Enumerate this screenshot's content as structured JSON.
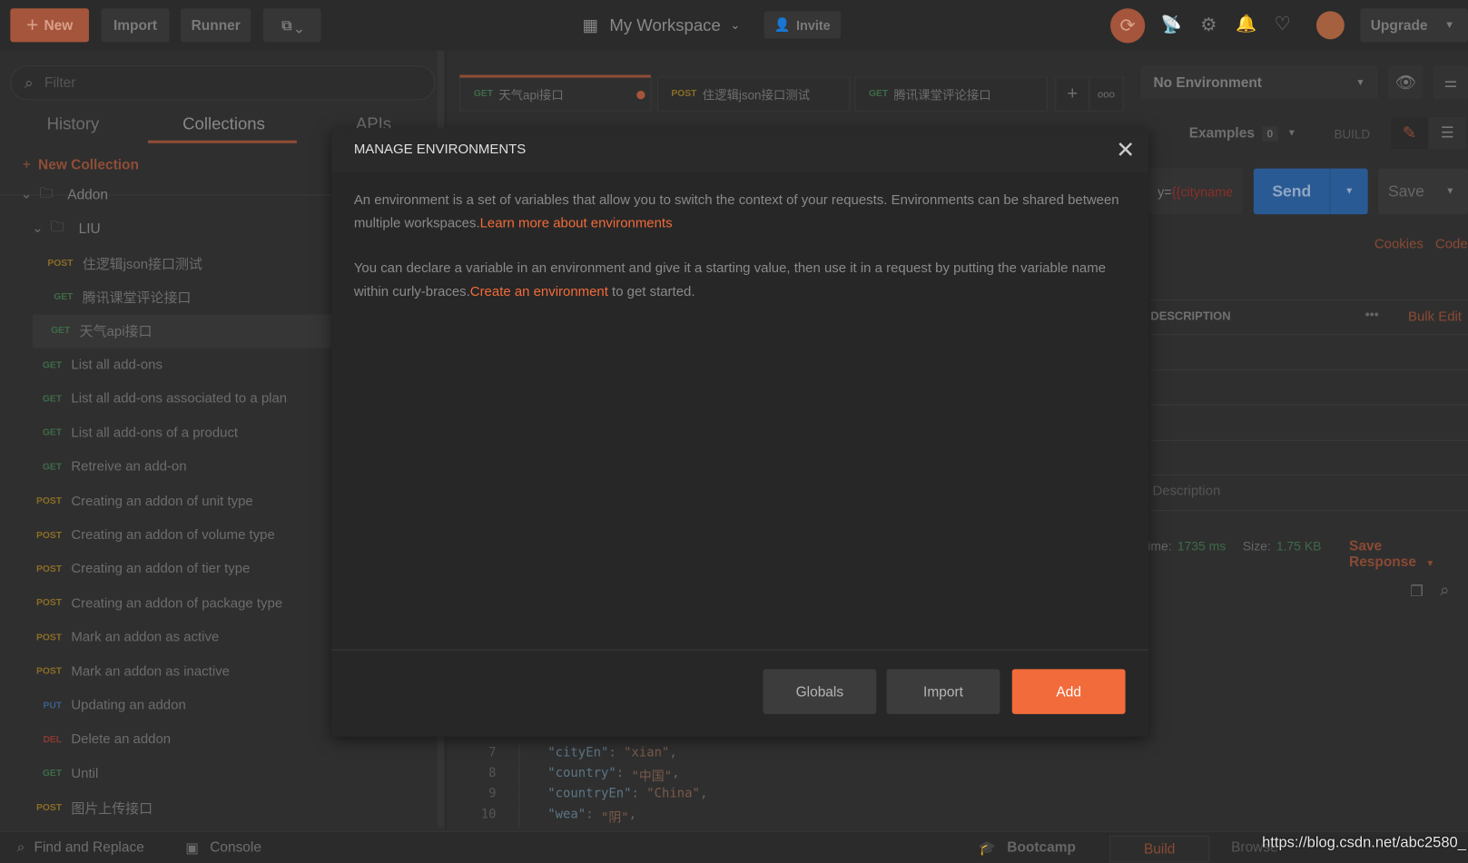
{
  "topbar": {
    "new_label": "New",
    "import_label": "Import",
    "runner_label": "Runner",
    "workspace_label": "My Workspace",
    "invite_label": "Invite",
    "upgrade_label": "Upgrade"
  },
  "sidebar": {
    "filter_placeholder": "Filter",
    "tabs": [
      {
        "label": "History"
      },
      {
        "label": "Collections",
        "active": true
      },
      {
        "label": "APIs"
      }
    ],
    "new_collection_label": "New Collection",
    "collection": "Addon",
    "folder": "LIU",
    "folder_items": [
      {
        "method": "POST",
        "name": "住逻辑json接口测试"
      },
      {
        "method": "GET",
        "name": "腾讯课堂评论接口"
      },
      {
        "method": "GET",
        "name": "天气api接口",
        "selected": true
      }
    ],
    "items": [
      {
        "method": "GET",
        "name": "List all add-ons"
      },
      {
        "method": "GET",
        "name": "List all add-ons associated to a plan"
      },
      {
        "method": "GET",
        "name": "List all add-ons of a product"
      },
      {
        "method": "GET",
        "name": "Retreive an add-on"
      },
      {
        "method": "POST",
        "name": "Creating an addon of unit type"
      },
      {
        "method": "POST",
        "name": "Creating an addon of volume type"
      },
      {
        "method": "POST",
        "name": "Creating an addon of tier type"
      },
      {
        "method": "POST",
        "name": "Creating an addon of package type"
      },
      {
        "method": "POST",
        "name": "Mark an addon as active"
      },
      {
        "method": "POST",
        "name": "Mark an addon as inactive"
      },
      {
        "method": "PUT",
        "name": "Updating an addon"
      },
      {
        "method": "DEL",
        "name": "Delete an addon"
      },
      {
        "method": "GET",
        "name": "Until"
      },
      {
        "method": "POST",
        "name": "图片上传接口"
      }
    ]
  },
  "tabs": [
    {
      "method": "GET",
      "name": "天气api接口",
      "unsaved": true
    },
    {
      "method": "POST",
      "name": "住逻辑json接口测试"
    },
    {
      "method": "GET",
      "name": "腾讯课堂评论接口"
    }
  ],
  "environment": {
    "selected": "No Environment"
  },
  "request": {
    "examples_label": "Examples",
    "examples_count": "0",
    "build_label": "BUILD",
    "url_tail_plain": "y=",
    "url_tail_var": "{{cityname",
    "send_label": "Send",
    "save_label": "Save",
    "cookies_label": "Cookies",
    "code_label": "Code",
    "description_header": "DESCRIPTION",
    "bulk_edit_label": "Bulk Edit",
    "description_placeholder": "Description"
  },
  "response": {
    "time_label": "ime:",
    "time_value": "1735 ms",
    "size_label": "Size:",
    "size_value": "1.75 KB",
    "save_response_label": "Save Response",
    "lines": [
      {
        "n": "7",
        "key": "\"cityEn\"",
        "val": "\"xian\""
      },
      {
        "n": "8",
        "key": "\"country\"",
        "val": "\"中国\""
      },
      {
        "n": "9",
        "key": "\"countryEn\"",
        "val": "\"China\""
      },
      {
        "n": "10",
        "key": "\"wea\"",
        "val": "\"阴\""
      }
    ]
  },
  "modal": {
    "title": "MANAGE ENVIRONMENTS",
    "para1": "An environment is a set of variables that allow you to switch the context of your requests. Environments can be shared between multiple workspaces.",
    "para1_link": "Learn more about environments",
    "para2": "You can declare a variable in an environment and give it a starting value, then use it in a request by putting the variable name within curly-braces.",
    "para2_link": "Create an environment",
    "para2_end": " to get started.",
    "globals_label": "Globals",
    "import_label": "Import",
    "add_label": "Add"
  },
  "bottom": {
    "find_replace_label": "Find and Replace",
    "console_label": "Console",
    "bootcamp_label": "Bootcamp",
    "build_label": "Build",
    "browse_label": "Browse"
  },
  "watermark": "https://blog.csdn.net/abc2580_",
  "colors": {
    "accent": "#f26b3a",
    "send": "#2a5a94",
    "get": "#3e6b48",
    "post": "#8a6d26"
  }
}
